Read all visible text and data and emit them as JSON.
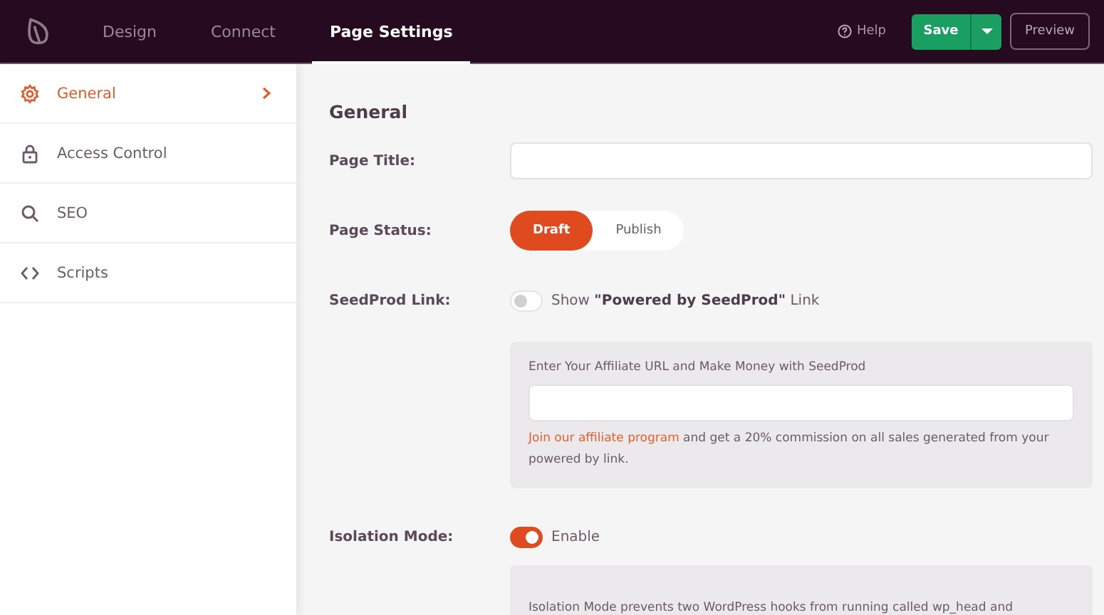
{
  "topbar": {
    "tabs": [
      {
        "label": "Design",
        "selected": false
      },
      {
        "label": "Connect",
        "selected": false
      },
      {
        "label": "Page Settings",
        "selected": true
      }
    ],
    "help": "Help",
    "save": "Save",
    "preview": "Preview"
  },
  "sidebar": {
    "items": [
      {
        "label": "General",
        "selected": true
      },
      {
        "label": "Access Control",
        "selected": false
      },
      {
        "label": "SEO",
        "selected": false
      },
      {
        "label": "Scripts",
        "selected": false
      }
    ]
  },
  "content": {
    "heading": "General",
    "page_title": {
      "label": "Page Title:"
    },
    "page_status": {
      "label": "Page Status:",
      "options": [
        {
          "label": "Draft",
          "selected": true
        },
        {
          "label": "Publish",
          "selected": false
        }
      ]
    },
    "seedprod_link": {
      "label": "SeedProd Link:",
      "on": false,
      "text": "Show **\"Powered by SeedProd\"** Link",
      "box": {
        "prompt": "Enter Your Affiliate URL and Make Money with SeedProd",
        "link": "Join our affiliate program",
        "note": "and get a 20% commission on all sales generated from your powered by link."
      }
    },
    "isolation_mode": {
      "label": "Isolation Mode:",
      "on": true,
      "text": "Enable",
      "box": {
        "text": "Isolation Mode prevents two WordPress hooks from running called wp_head and"
      }
    }
  }
}
